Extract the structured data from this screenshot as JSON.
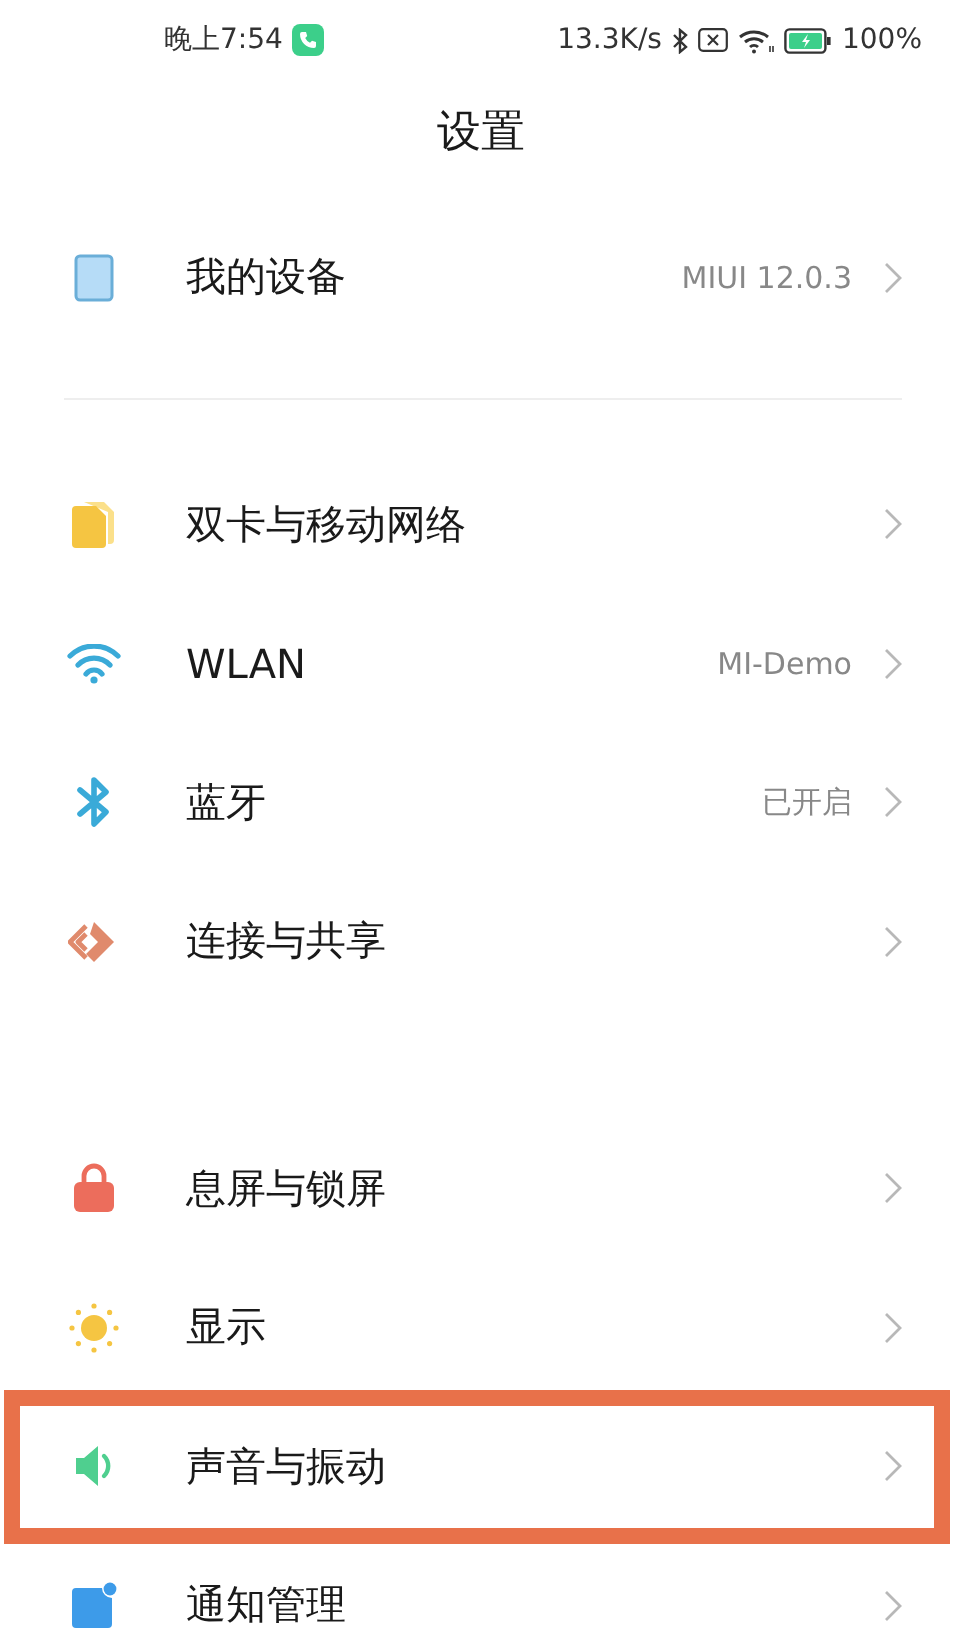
{
  "status_bar": {
    "time": "晚上7:54",
    "speed": "13.3K/s",
    "battery": "100%"
  },
  "title": "设置",
  "groups": [
    [
      {
        "label": "我的设备",
        "value": "MIUI 12.0.3",
        "highlighted": false
      }
    ],
    [
      {
        "label": "双卡与移动网络",
        "highlighted": false
      },
      {
        "label": "WLAN",
        "value": "MI-Demo",
        "highlighted": false
      },
      {
        "label": "蓝牙",
        "value": "已开启",
        "highlighted": false
      },
      {
        "label": "连接与共享",
        "highlighted": false
      }
    ],
    [
      {
        "label": "息屏与锁屏",
        "highlighted": false
      },
      {
        "label": "显示",
        "highlighted": false
      },
      {
        "label": "声音与振动",
        "highlighted": true
      },
      {
        "label": "通知管理",
        "highlighted": false
      }
    ]
  ]
}
